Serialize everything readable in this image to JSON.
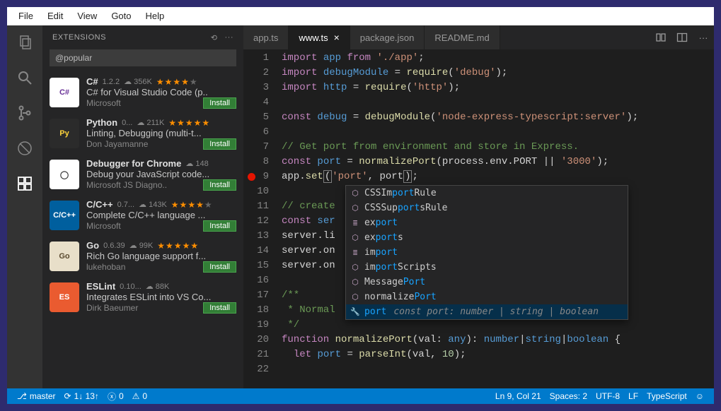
{
  "menu": {
    "items": [
      "File",
      "Edit",
      "View",
      "Goto",
      "Help"
    ]
  },
  "activity": {
    "items": [
      "files-icon",
      "search-icon",
      "git-icon",
      "debug-icon",
      "extensions-icon"
    ],
    "active": 4
  },
  "sidebar": {
    "title": "EXTENSIONS",
    "search": "@popular",
    "items": [
      {
        "name": "C#",
        "version": "1.2.2",
        "downloads": "356K",
        "stars": 4,
        "desc": "C# for Visual Studio Code (p..",
        "publisher": "Microsoft",
        "install": "Install",
        "iconBg": "#fff",
        "iconFg": "#683097",
        "iconText": "C#"
      },
      {
        "name": "Python",
        "version": "0...",
        "downloads": "211K",
        "stars": 5,
        "desc": "Linting, Debugging (multi-t...",
        "publisher": "Don Jayamanne",
        "install": "Install",
        "iconBg": "#2b2b2b",
        "iconFg": "#ffd43b",
        "iconText": "Py"
      },
      {
        "name": "Debugger for Chrome",
        "version": "",
        "downloads": "148",
        "stars": 0,
        "desc": "Debug your JavaScript code...",
        "publisher": "Microsoft JS Diagno..",
        "install": "Install",
        "iconBg": "#fff",
        "iconFg": "#333",
        "iconText": "◯"
      },
      {
        "name": "C/C++",
        "version": "0.7...",
        "downloads": "143K",
        "stars": 4,
        "desc": "Complete C/C++ language ...",
        "publisher": "Microsoft",
        "install": "Install",
        "iconBg": "#005f9e",
        "iconFg": "#fff",
        "iconText": "C/C++"
      },
      {
        "name": "Go",
        "version": "0.6.39",
        "downloads": "99K",
        "stars": 5,
        "desc": "Rich Go language support f...",
        "publisher": "lukehoban",
        "install": "Install",
        "iconBg": "#e8dfc9",
        "iconFg": "#5a4a2f",
        "iconText": "Go"
      },
      {
        "name": "ESLint",
        "version": "0.10...",
        "downloads": "88K",
        "stars": 0,
        "desc": "Integrates ESLint into VS Co...",
        "publisher": "Dirk Baeumer",
        "install": "Install",
        "iconBg": "#ea5b30",
        "iconFg": "#fff",
        "iconText": "ES"
      }
    ]
  },
  "tabs": {
    "items": [
      {
        "label": "app.ts",
        "active": false
      },
      {
        "label": "www.ts",
        "active": true
      },
      {
        "label": "package.json",
        "active": false
      },
      {
        "label": "README.md",
        "active": false
      }
    ]
  },
  "code": {
    "breakpointLine": 9,
    "lines": [
      [
        "kw:import",
        " ",
        "bl:app",
        " ",
        "kw:from",
        " ",
        "str:'./app'",
        ";"
      ],
      [
        "kw:import",
        " ",
        "bl:debugModule",
        " = ",
        "fn:require",
        "(",
        "str:'debug'",
        ");"
      ],
      [
        "kw:import",
        " ",
        "bl:http",
        " = ",
        "fn:require",
        "(",
        "str:'http'",
        ");"
      ],
      [],
      [
        "kw:const",
        " ",
        "bl:debug",
        " = ",
        "fn:debugModule",
        "(",
        "str:'node-express-typescript:server'",
        ");"
      ],
      [],
      [
        "cm:// Get port from environment and store in Express."
      ],
      [
        "kw:const",
        " ",
        "bl:port",
        " = ",
        "fn:normalizePort",
        "(process.env.PORT || ",
        "str:'3000'",
        ");"
      ],
      [
        "app.",
        "fn:set",
        "box:(",
        "str:'port'",
        ", port",
        "box:)",
        ";"
      ],
      [],
      [
        "cm:// create"
      ],
      [
        "kw:const",
        " ",
        "bl:ser"
      ],
      [
        "server.li"
      ],
      [
        "server.on"
      ],
      [
        "server.on"
      ],
      [],
      [
        "cm:/**"
      ],
      [
        "cm: * Normal"
      ],
      [
        "cm: */"
      ],
      [
        "kw:function",
        " ",
        "fn:normalizePort",
        "(val: ",
        "bl:any",
        "): ",
        "bl:number",
        "|",
        "bl:string",
        "|",
        "bl:boolean",
        " {"
      ],
      [
        "  ",
        "kw:let",
        " ",
        "bl:port",
        " = ",
        "fn:parseInt",
        "(val, ",
        "num:10",
        ");"
      ],
      []
    ]
  },
  "suggest": {
    "items": [
      {
        "pre": "CSSIm",
        "hl": "port",
        "post": "Rule",
        "icon": "⬡"
      },
      {
        "pre": "CSSSup",
        "hl": "port",
        "post": "sRule",
        "icon": "⬡"
      },
      {
        "pre": "ex",
        "hl": "port",
        "post": "",
        "icon": "≣"
      },
      {
        "pre": "ex",
        "hl": "port",
        "post": "s",
        "icon": "⬡"
      },
      {
        "pre": "im",
        "hl": "port",
        "post": "",
        "icon": "≣"
      },
      {
        "pre": "im",
        "hl": "port",
        "post": "Scripts",
        "icon": "⬡"
      },
      {
        "pre": "Message",
        "hl": "Port",
        "post": "",
        "icon": "⬡"
      },
      {
        "pre": "normalize",
        "hl": "Port",
        "post": "",
        "icon": "⬡"
      },
      {
        "pre": "",
        "hl": "port",
        "post": "",
        "icon": "🔧",
        "detail": "const port: number | string | boolean",
        "selected": true
      }
    ]
  },
  "status": {
    "branch": "master",
    "sync": "1↓ 13↑",
    "errors": "0",
    "warnings": "0",
    "pos": "Ln 9, Col 21",
    "spaces": "Spaces: 2",
    "enc": "UTF-8",
    "eol": "LF",
    "lang": "TypeScript"
  }
}
